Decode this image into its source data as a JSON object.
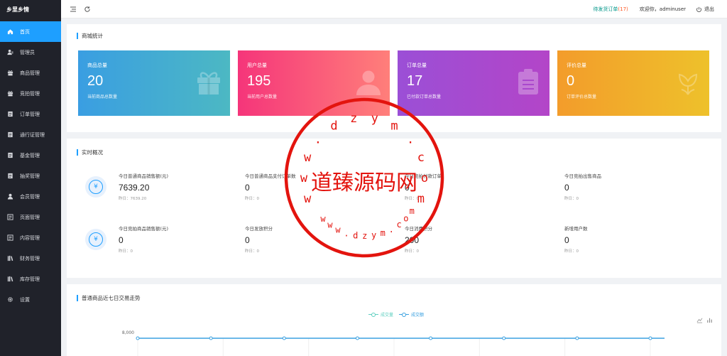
{
  "sidebar": {
    "brand": "乡里乡情",
    "items": [
      {
        "label": "首页",
        "icon": "home-icon"
      },
      {
        "label": "管理员",
        "icon": "admin-user-icon"
      },
      {
        "label": "商品管理",
        "icon": "gift-icon"
      },
      {
        "label": "竞拍管理",
        "icon": "gift-icon"
      },
      {
        "label": "订单管理",
        "icon": "list-icon"
      },
      {
        "label": "通行证管理",
        "icon": "list-icon"
      },
      {
        "label": "基金管理",
        "icon": "list-icon"
      },
      {
        "label": "抽奖管理",
        "icon": "list-icon"
      },
      {
        "label": "会员管理",
        "icon": "user-icon"
      },
      {
        "label": "页面管理",
        "icon": "page-icon"
      },
      {
        "label": "内容管理",
        "icon": "page-icon"
      },
      {
        "label": "财务管理",
        "icon": "books-icon"
      },
      {
        "label": "库存管理",
        "icon": "books-icon"
      },
      {
        "label": "设置",
        "icon": "gear-icon"
      }
    ]
  },
  "topbar": {
    "pending_label": "待发货订单",
    "pending_count": "(17)",
    "welcome": "欢迎你，adminuser",
    "logout": "退出"
  },
  "mall_stats": {
    "title": "商城统计",
    "cards": [
      {
        "label": "商品总量",
        "value": "20",
        "sub": "当前商品总数量",
        "icon": "gift-icon",
        "colors": [
          "#3a9ee2",
          "#4cb8c3"
        ]
      },
      {
        "label": "用户总量",
        "value": "195",
        "sub": "当前用户总数量",
        "icon": "user-icon",
        "colors": [
          "#f5357a",
          "#ff7f7a"
        ]
      },
      {
        "label": "订单总量",
        "value": "17",
        "sub": "已付款订单总数量",
        "icon": "clipboard-icon",
        "colors": [
          "#9b4fd6",
          "#b345c8"
        ]
      },
      {
        "label": "评价总量",
        "value": "0",
        "sub": "订单评价总数量",
        "icon": "flower-icon",
        "colors": [
          "#f39c2b",
          "#eec12b"
        ]
      }
    ]
  },
  "realtime": {
    "title": "实时概况",
    "items": [
      {
        "label": "今日普通商品销售额(元)",
        "value": "7639.20",
        "prev": "昨日：7639.20"
      },
      {
        "label": "今日普通商品支付订单数",
        "value": "0",
        "prev": "昨日：0"
      },
      {
        "label": "今日竞拍付款订单",
        "value": "0",
        "prev": "昨日：0"
      },
      {
        "label": "今日竞拍出售商品",
        "value": "0",
        "prev": "昨日：0"
      },
      {
        "label": "今日竞拍商品销售额(元)",
        "value": "0",
        "prev": "昨日：0"
      },
      {
        "label": "今日发放积分",
        "value": "0",
        "prev": "昨日：0"
      },
      {
        "label": "今日消费积分",
        "value": "200",
        "prev": "昨日：0"
      },
      {
        "label": "新增用户数",
        "value": "0",
        "prev": "昨日：0"
      }
    ]
  },
  "trend": {
    "title": "普通商品近七日交易走势",
    "legend": [
      "成交量",
      "成交额"
    ],
    "y_tick_top": "8,000"
  },
  "chart_data": {
    "type": "line",
    "title": "普通商品近七日交易走势",
    "series": [
      {
        "name": "成交量"
      },
      {
        "name": "成交额",
        "values": [
          8000,
          8000,
          8000,
          8000,
          8000,
          8000,
          8000,
          8000,
          8000
        ]
      }
    ],
    "y_ticks": [
      "8,000"
    ],
    "legend_position": "top-center"
  },
  "watermark": {
    "text": "道臻源码网",
    "ring_text": "www.dzym.com"
  }
}
